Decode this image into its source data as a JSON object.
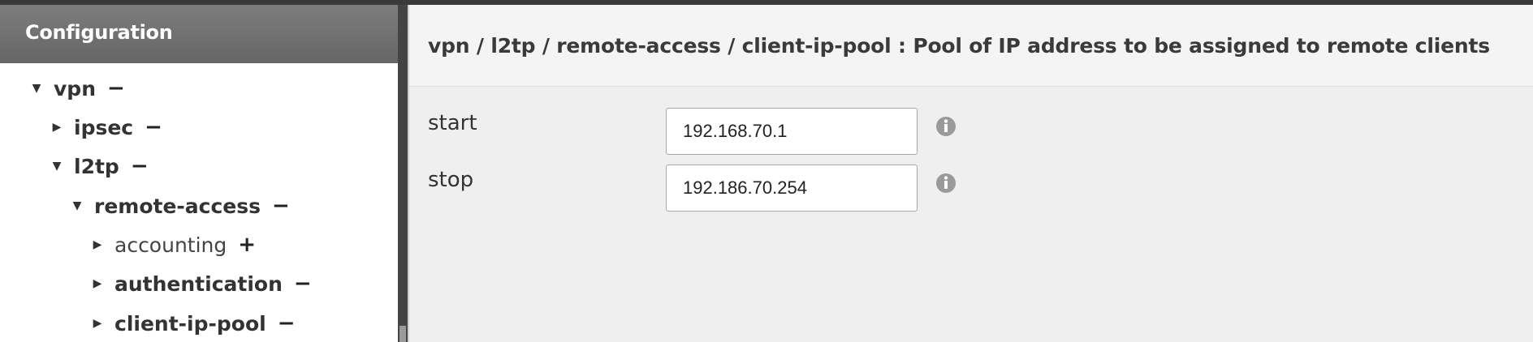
{
  "sidebar": {
    "title": "Configuration",
    "tree": [
      {
        "label": "vpn",
        "expanded": true,
        "bold": true,
        "action": "−"
      },
      {
        "label": "ipsec",
        "expanded": false,
        "bold": true,
        "action": "−"
      },
      {
        "label": "l2tp",
        "expanded": true,
        "bold": true,
        "action": "−"
      },
      {
        "label": "remote-access",
        "expanded": true,
        "bold": true,
        "action": "−"
      },
      {
        "label": "accounting",
        "expanded": false,
        "bold": false,
        "action": "+"
      },
      {
        "label": "authentication",
        "expanded": false,
        "bold": true,
        "action": "−"
      },
      {
        "label": "client-ip-pool",
        "expanded": false,
        "bold": true,
        "action": "−"
      }
    ]
  },
  "main": {
    "title": "vpn / l2tp / remote-access / client-ip-pool : Pool of IP address to be assigned to remote clients",
    "fields": [
      {
        "label": "start",
        "value": "192.168.70.1"
      },
      {
        "label": "stop",
        "value": "192.186.70.254"
      }
    ]
  },
  "colors": {
    "sidebar_header": "#6f6f6f",
    "panel_bg": "#efefef",
    "info_icon": "#9a9a9a"
  },
  "icons": {
    "expanded": "caret-down-icon",
    "collapsed": "caret-right-icon",
    "info": "info-icon"
  }
}
